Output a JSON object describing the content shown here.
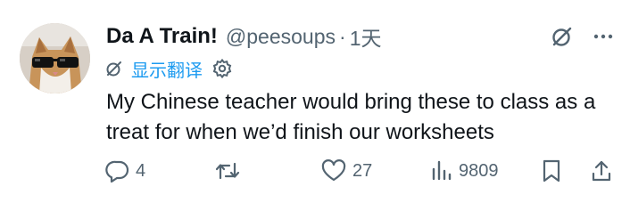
{
  "tweet": {
    "display_name": "Da A Train!",
    "handle": "@peesoups",
    "separator": "·",
    "timestamp": "1天",
    "translate_label": "显示翻译",
    "text": "My Chinese teacher would bring these to class as a treat for when we’d finish our worksheets",
    "avatar_icon": "cat-with-sunglasses-avatar"
  },
  "actions": {
    "reply_count": "4",
    "retweet_count": "",
    "like_count": "27",
    "views_count": "9809"
  },
  "colors": {
    "text": "#0f1419",
    "secondary": "#536471",
    "link": "#1d9bf0",
    "background": "#ffffff"
  }
}
